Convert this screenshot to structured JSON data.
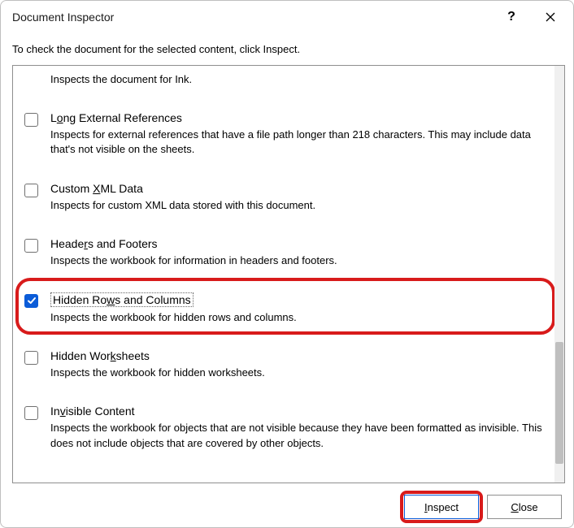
{
  "title": "Document Inspector",
  "instruction": "To check the document for the selected content, click Inspect.",
  "items": {
    "ink": {
      "desc": "Inspects the document for Ink."
    },
    "longExtRefs": {
      "title_pre": "L",
      "title_access": "o",
      "title_post": "ng External References",
      "desc": "Inspects for external references that have a file path longer than 218 characters. This may include data that's not visible on the sheets.",
      "checked": false
    },
    "customXml": {
      "title_pre": "Custom ",
      "title_access": "X",
      "title_post": "ML Data",
      "desc": "Inspects for custom XML data stored with this document.",
      "checked": false
    },
    "headersFooters": {
      "title_pre": "Heade",
      "title_access": "r",
      "title_post": "s and Footers",
      "desc": "Inspects the workbook for information in headers and footers.",
      "checked": false
    },
    "hiddenRowsCols": {
      "title_pre": "Hidden Ro",
      "title_access": "w",
      "title_post": "s and Columns",
      "desc": "Inspects the workbook for hidden rows and columns.",
      "checked": true
    },
    "hiddenWorksheets": {
      "title_pre": "Hidden Wor",
      "title_access": "k",
      "title_post": "sheets",
      "desc": "Inspects the workbook for hidden worksheets.",
      "checked": false
    },
    "invisibleContent": {
      "title_pre": "In",
      "title_access": "v",
      "title_post": "isible Content",
      "desc": "Inspects the workbook for objects that are not visible because they have been formatted as invisible. This does not include objects that are covered by other objects.",
      "checked": false
    }
  },
  "buttons": {
    "inspect_pre": "",
    "inspect_access": "I",
    "inspect_post": "nspect",
    "close_pre": "",
    "close_access": "C",
    "close_post": "lose"
  }
}
